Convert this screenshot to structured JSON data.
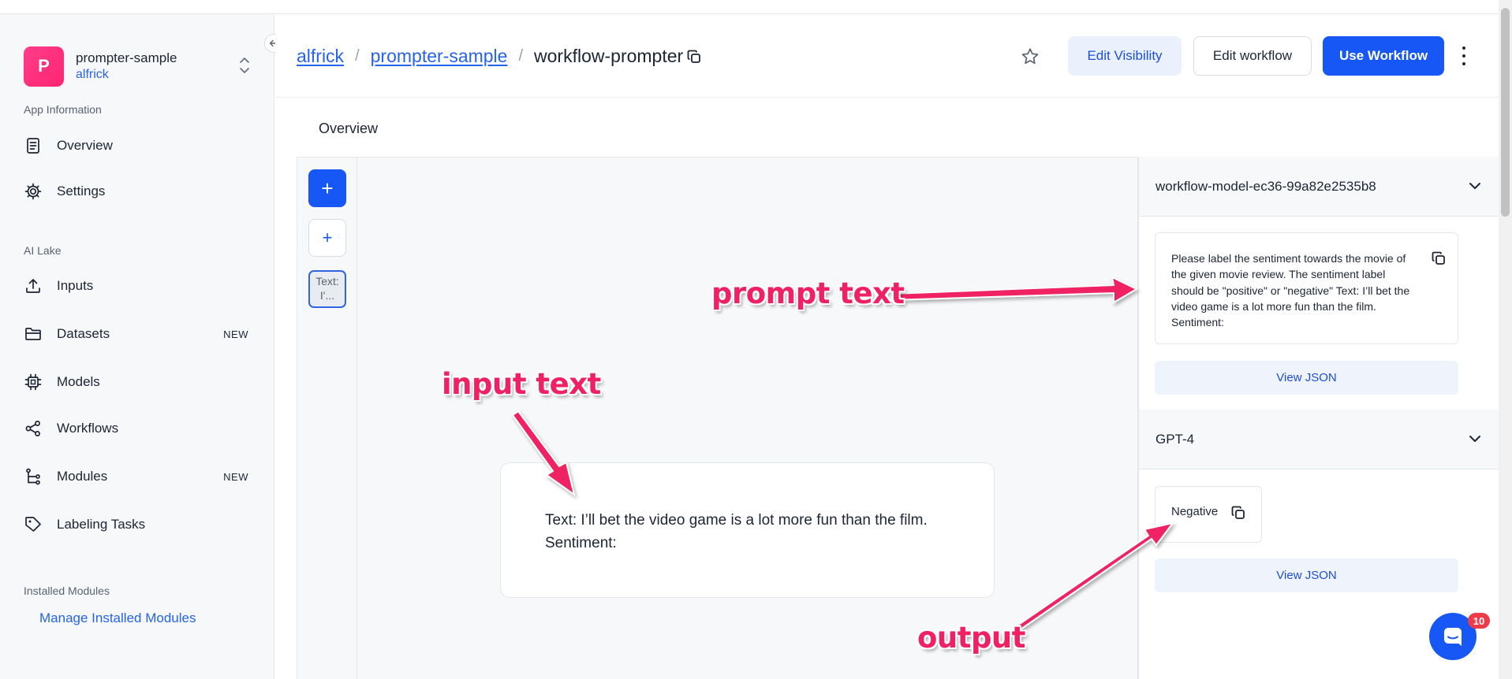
{
  "app": {
    "avatar_letter": "P",
    "name": "prompter-sample",
    "owner": "alfrick"
  },
  "sidebar": {
    "sections": {
      "app_information": "App Information",
      "ai_lake": "AI Lake",
      "installed_modules": "Installed Modules"
    },
    "items": [
      {
        "label": "Overview",
        "icon": "document-icon"
      },
      {
        "label": "Settings",
        "icon": "gear-icon"
      },
      {
        "label": "Inputs",
        "icon": "upload-icon"
      },
      {
        "label": "Datasets",
        "icon": "folder-icon",
        "badge": "NEW"
      },
      {
        "label": "Models",
        "icon": "chip-icon"
      },
      {
        "label": "Workflows",
        "icon": "share-icon"
      },
      {
        "label": "Modules",
        "icon": "branch-icon",
        "badge": "NEW"
      },
      {
        "label": "Labeling Tasks",
        "icon": "tag-icon"
      }
    ],
    "manage_link": "Manage Installed Modules"
  },
  "header": {
    "breadcrumb": [
      "alfrick",
      "prompter-sample",
      "workflow-prompter"
    ],
    "separator": "/",
    "buttons": {
      "edit_visibility": "Edit Visibility",
      "edit_workflow": "Edit workflow",
      "use_workflow": "Use Workflow"
    }
  },
  "overview_tab": "Overview",
  "canvas": {
    "add_primary": "+",
    "add_secondary": "+",
    "node_label": "Text: I'...",
    "input_line1": "Text: I’ll bet the video game is a lot more fun than the film.",
    "input_line2": "Sentiment:"
  },
  "panel": {
    "model_node": "workflow-model-ec36-99a82e2535b8",
    "prompt_text": "Please label the sentiment towards the movie of the given movie review. The sentiment label should be \"positive\" or \"negative\" Text: I’ll bet the video game is a lot more fun than the film. Sentiment:",
    "view_json_1": "View JSON",
    "gpt_node": "GPT-4",
    "output_text": "Negative",
    "view_json_2": "View JSON"
  },
  "chat": {
    "badge_count": "10"
  },
  "annotations": {
    "prompt": "prompt text",
    "input": "input text",
    "output": "output"
  },
  "colors": {
    "primary": "#1657f5",
    "link": "#2563eb",
    "annotation": "#ef2063",
    "avatar": "#ff2472"
  }
}
